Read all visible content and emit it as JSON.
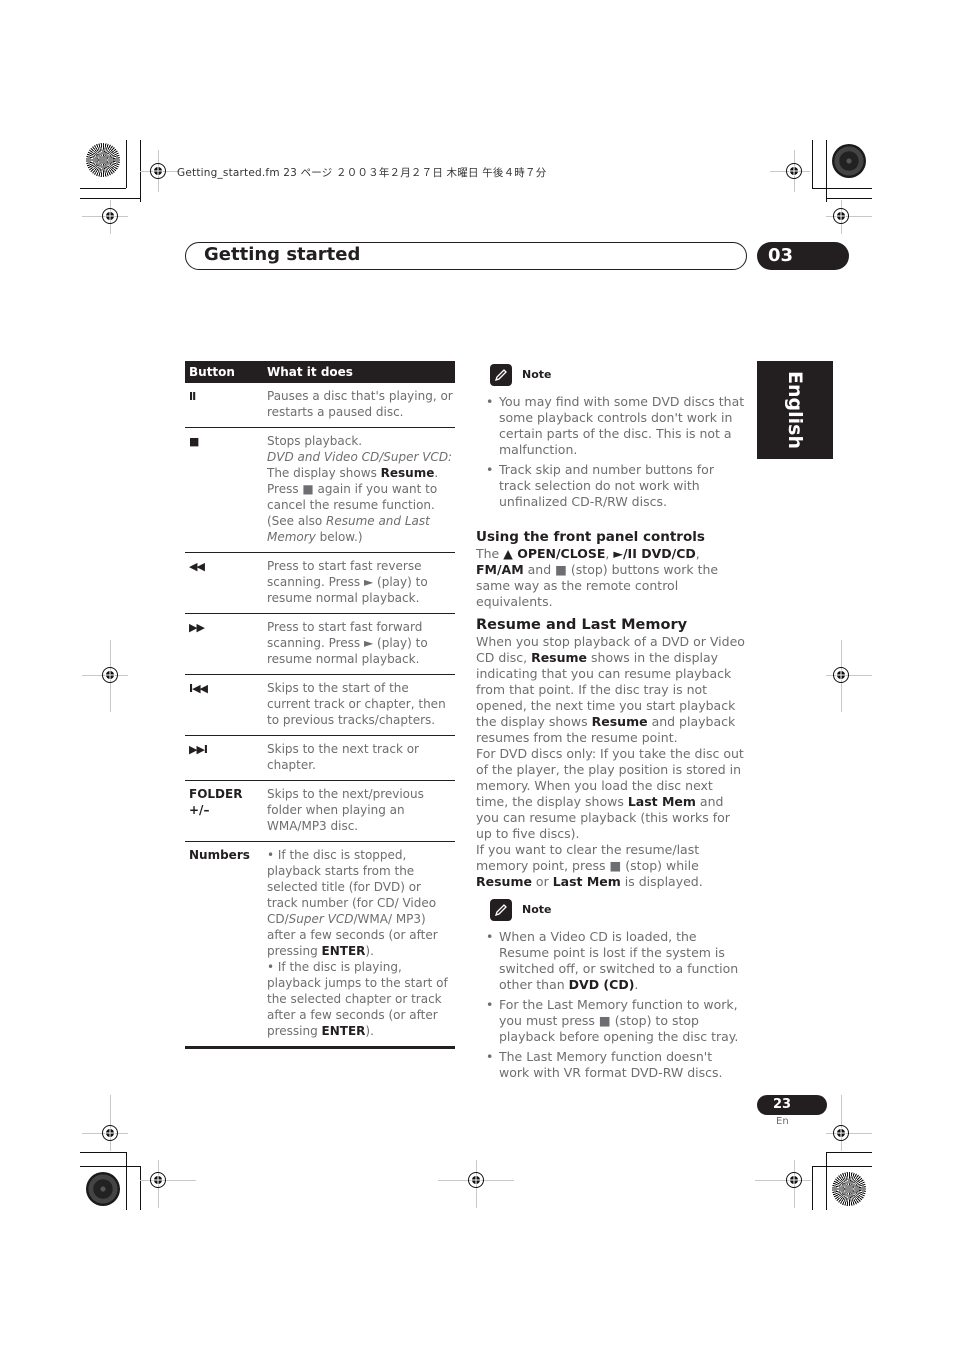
{
  "file_info": "Getting_started.fm  23 ページ  ２００３年２月２７日  木曜日  午後４時７分",
  "header": {
    "chapter_title": "Getting started",
    "chapter_number": "03"
  },
  "language_tab": "English",
  "table": {
    "headers": [
      "Button",
      "What it does"
    ],
    "rows": [
      {
        "button": "II",
        "button_icon": "pause-icon",
        "description": "Pauses a disc that's playing, or restarts a paused disc."
      },
      {
        "button": "■",
        "button_icon": "stop-icon",
        "description_parts": {
          "line1": "Stops playback.",
          "italic1": "DVD and Video CD/Super VCD:",
          "text2": "The display shows ",
          "bold1": "Resume",
          "text3": ".",
          "text4": "Press ■ again if you want to cancel the resume function. (See also ",
          "italic2": "Resume and Last Memory",
          "text5": " below.)"
        }
      },
      {
        "button": "◀◀",
        "button_icon": "fast-reverse-icon",
        "description": "Press to start fast reverse scanning. Press ► (play) to resume normal playback."
      },
      {
        "button": "▶▶",
        "button_icon": "fast-forward-icon",
        "description": "Press to start fast forward scanning. Press ► (play) to resume normal playback."
      },
      {
        "button": "I◀◀",
        "button_icon": "skip-previous-icon",
        "description": "Skips to the start of the current track or chapter, then to previous tracks/chapters."
      },
      {
        "button": "▶▶I",
        "button_icon": "skip-next-icon",
        "description": "Skips to the next track or chapter."
      },
      {
        "button": "FOLDER +/–",
        "description": "Skips to the next/previous folder when playing an WMA/MP3 disc."
      },
      {
        "button": "Numbers",
        "description_parts": {
          "p1a": "• If the disc is stopped, playback starts from the selected title (for DVD) or track number (for CD/ Video CD/",
          "p1i": "Super VCD",
          "p1b": "/WMA/ MP3) after a few seconds (or after pressing ",
          "p1bold": "ENTER",
          "p1c": ").",
          "p2a": "• If the disc is playing, playback jumps to the start of the selected chapter or track after a few seconds (or after pressing ",
          "p2bold": "ENTER",
          "p2c": ")."
        }
      }
    ]
  },
  "note1": {
    "label": "Note",
    "items": [
      "You may find with some DVD discs that some playback controls don't work in certain parts of the disc. This is not a malfunction.",
      "Track skip and number buttons for track selection do not work with unfinalized CD-R/RW discs."
    ]
  },
  "front_panel": {
    "title": "Using the front panel controls",
    "t1": "The ",
    "b1": "▲ OPEN/CLOSE",
    "t2": ", ",
    "b2": "►/II DVD/CD",
    "t3": ", ",
    "b3": "FM/AM",
    "t4": " and ■ (stop) buttons work the same way as the remote control equivalents."
  },
  "resume": {
    "title": "Resume and Last Memory",
    "p1a": "When you stop playback of a DVD or Video CD disc, ",
    "p1b": "Resume",
    "p1c": " shows in the display indicating that you can resume playback from that point. If the disc tray is not opened, the next time you start playback the display shows ",
    "p1d": "Resume",
    "p1e": " and playback resumes from the resume point.",
    "p2a": "For DVD discs only: If you take the disc out of the player, the play position is stored in memory. When you load the disc next time, the display shows ",
    "p2b": "Last Mem",
    "p2c": " and you can resume playback (this works for up to five discs).",
    "p3a": "If you want to clear the resume/last memory point, press ■ (stop) while ",
    "p3b": "Resume",
    "p3c": " or ",
    "p3d": "Last Mem",
    "p3e": " is displayed."
  },
  "note2": {
    "label": "Note",
    "item1a": "When a Video CD is loaded, the Resume point is lost if the system is switched off, or switched to a function other than ",
    "item1b": "DVD (CD)",
    "item1c": ".",
    "item2": "For the Last Memory function to work, you must press ■ (stop) to stop playback before opening the disc tray.",
    "item3": "The Last Memory function doesn't work with VR format DVD-RW discs."
  },
  "footer": {
    "page_number": "23",
    "language_code": "En"
  }
}
